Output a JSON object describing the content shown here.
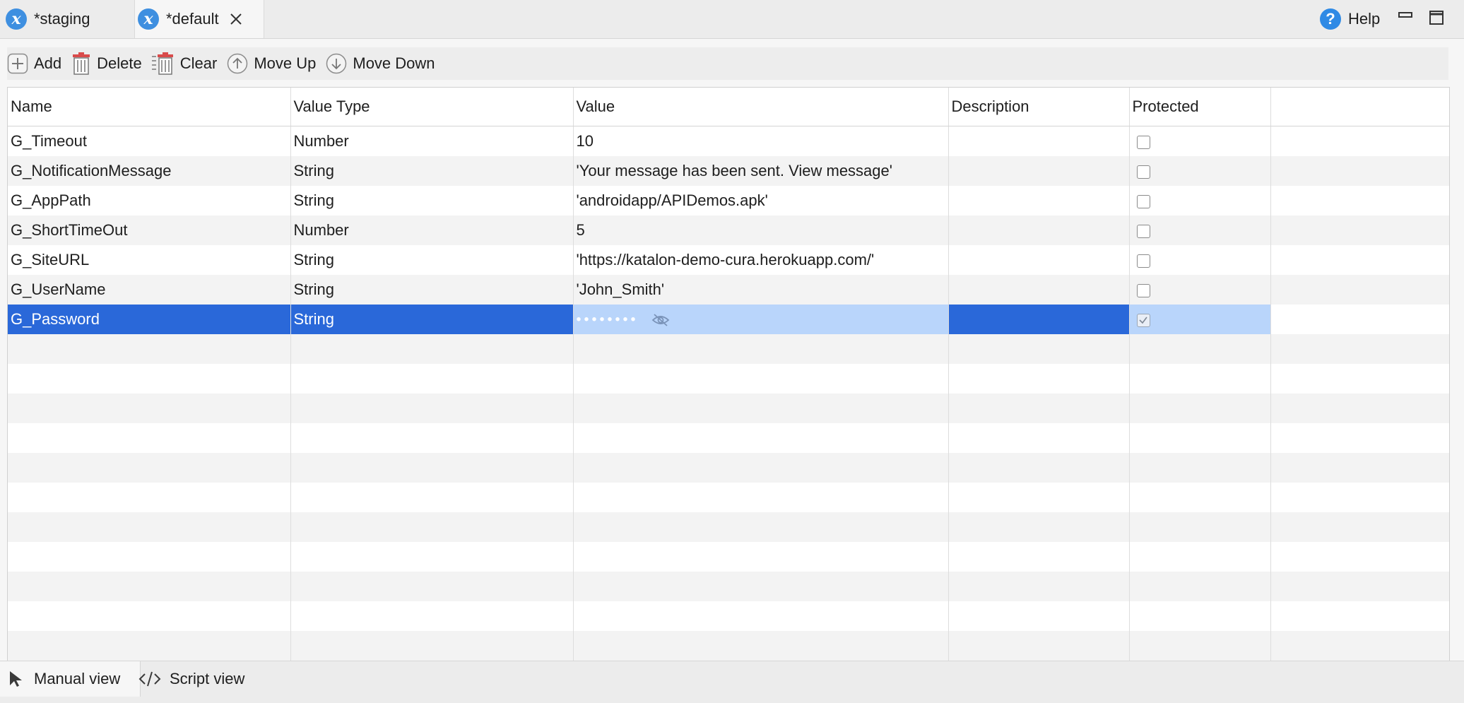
{
  "tabs": [
    {
      "label": "*staging",
      "icon": "variable-x-icon"
    },
    {
      "label": "*default",
      "icon": "variable-x-icon",
      "active": true
    }
  ],
  "help_label": "Help",
  "toolbar": {
    "add": "Add",
    "delete": "Delete",
    "clear": "Clear",
    "move_up": "Move Up",
    "move_down": "Move Down"
  },
  "table": {
    "headers": [
      "Name",
      "Value Type",
      "Value",
      "Description",
      "Protected"
    ],
    "rows": [
      {
        "name": "G_Timeout",
        "type": "Number",
        "value": "10",
        "description": "",
        "protected": false
      },
      {
        "name": "G_NotificationMessage",
        "type": "String",
        "value": "'Your message has been sent. View message'",
        "description": "",
        "protected": false
      },
      {
        "name": "G_AppPath",
        "type": "String",
        "value": "'androidapp/APIDemos.apk'",
        "description": "",
        "protected": false
      },
      {
        "name": "G_ShortTimeOut",
        "type": "Number",
        "value": "5",
        "description": "",
        "protected": false
      },
      {
        "name": "G_SiteURL",
        "type": "String",
        "value": "'https://katalon-demo-cura.herokuapp.com/'",
        "description": "",
        "protected": false
      },
      {
        "name": "G_UserName",
        "type": "String",
        "value": "'John_Smith'",
        "description": "",
        "protected": false
      },
      {
        "name": "G_Password",
        "type": "String",
        "value": "••••••••",
        "description": "",
        "protected": true,
        "selected": true
      }
    ]
  },
  "bottom_tabs": {
    "manual": "Manual view",
    "script": "Script view"
  },
  "colors": {
    "selection": "#2a68d9",
    "selection_light": "#b9d5fb",
    "icon_blue": "#3e8fe0"
  }
}
